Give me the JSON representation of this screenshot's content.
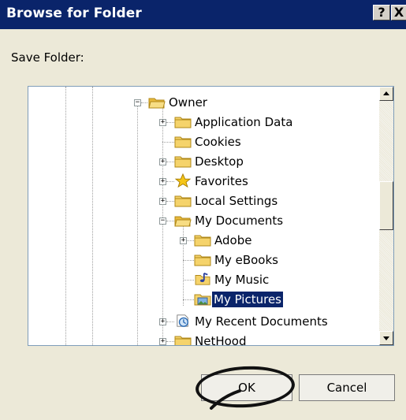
{
  "window": {
    "title": "Browse for Folder",
    "help_button": "?",
    "close_button": "X"
  },
  "prompt": "Save Folder:",
  "tree": {
    "items": [
      {
        "label": "Owner",
        "icon": "folder-open-icon",
        "expander": "−"
      },
      {
        "label": "Application Data",
        "icon": "folder-icon",
        "expander": "+"
      },
      {
        "label": "Cookies",
        "icon": "folder-icon",
        "expander": ""
      },
      {
        "label": "Desktop",
        "icon": "folder-icon",
        "expander": "+"
      },
      {
        "label": "Favorites",
        "icon": "star-folder-icon",
        "expander": "+"
      },
      {
        "label": "Local Settings",
        "icon": "folder-icon",
        "expander": "+"
      },
      {
        "label": "My Documents",
        "icon": "folder-open-icon",
        "expander": "−"
      },
      {
        "label": "Adobe",
        "icon": "folder-icon",
        "expander": "+"
      },
      {
        "label": "My eBooks",
        "icon": "folder-icon",
        "expander": ""
      },
      {
        "label": "My Music",
        "icon": "music-folder-icon",
        "expander": ""
      },
      {
        "label": "My Pictures",
        "icon": "pictures-folder-icon",
        "expander": "",
        "selected": true
      },
      {
        "label": "My Recent Documents",
        "icon": "recent-documents-icon",
        "expander": "+"
      },
      {
        "label": "NetHood",
        "icon": "folder-icon",
        "expander": "+"
      }
    ]
  },
  "buttons": {
    "ok": "OK",
    "cancel": "Cancel"
  },
  "colors": {
    "titlebar": "#0a246a",
    "dialog_bg": "#ece9d8",
    "selection": "#0a246a",
    "folder": "#f5d36b"
  }
}
